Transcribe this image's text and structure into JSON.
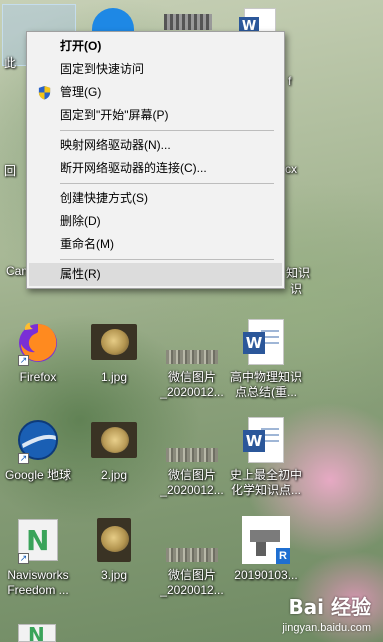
{
  "desktop": {
    "icons": [
      {
        "id": "firefox",
        "label": "Firefox"
      },
      {
        "id": "jpg1",
        "label": "1.jpg"
      },
      {
        "id": "wechat1",
        "label": "微信图片\n_2020012..."
      },
      {
        "id": "doc1",
        "label": "高中物理知识\n点总结(重..."
      },
      {
        "id": "google-earth",
        "label": "Google 地球"
      },
      {
        "id": "jpg2",
        "label": "2.jpg"
      },
      {
        "id": "wechat2",
        "label": "微信图片\n_2020012..."
      },
      {
        "id": "doc2",
        "label": "史上最全初中\n化学知识点..."
      },
      {
        "id": "navisworks",
        "label": "Navisworks\nFreedom ..."
      },
      {
        "id": "jpg3",
        "label": "3.jpg"
      },
      {
        "id": "wechat3",
        "label": "微信图片\n_2020012..."
      },
      {
        "id": "revit",
        "label": "20190103..."
      }
    ],
    "peek_labels": {
      "left_top": "此",
      "left_mid": "回",
      "left_cam": "Cam",
      "right_f": "f",
      "right_cx": "cx",
      "right_zhishi": "知识",
      "right_shi": "识"
    }
  },
  "context_menu": {
    "items": [
      {
        "label": "打开(O)",
        "bold": true
      },
      {
        "label": "固定到快速访问"
      },
      {
        "label": "管理(G)",
        "icon": "uac-shield-icon"
      },
      {
        "label": "固定到\"开始\"屏幕(P)"
      },
      {
        "sep": true
      },
      {
        "label": "映射网络驱动器(N)..."
      },
      {
        "label": "断开网络驱动器的连接(C)..."
      },
      {
        "sep": true
      },
      {
        "label": "创建快捷方式(S)"
      },
      {
        "label": "删除(D)"
      },
      {
        "label": "重命名(M)"
      },
      {
        "sep": true
      },
      {
        "label": "属性(R)",
        "hover": true
      }
    ]
  },
  "watermark": {
    "brand": "Bai 经验",
    "site": "jingyan.baidu.com"
  },
  "colors": {
    "menu_bg": "#f2f2f2",
    "menu_hover": "#dcdcdc",
    "word_blue": "#2b579a"
  }
}
